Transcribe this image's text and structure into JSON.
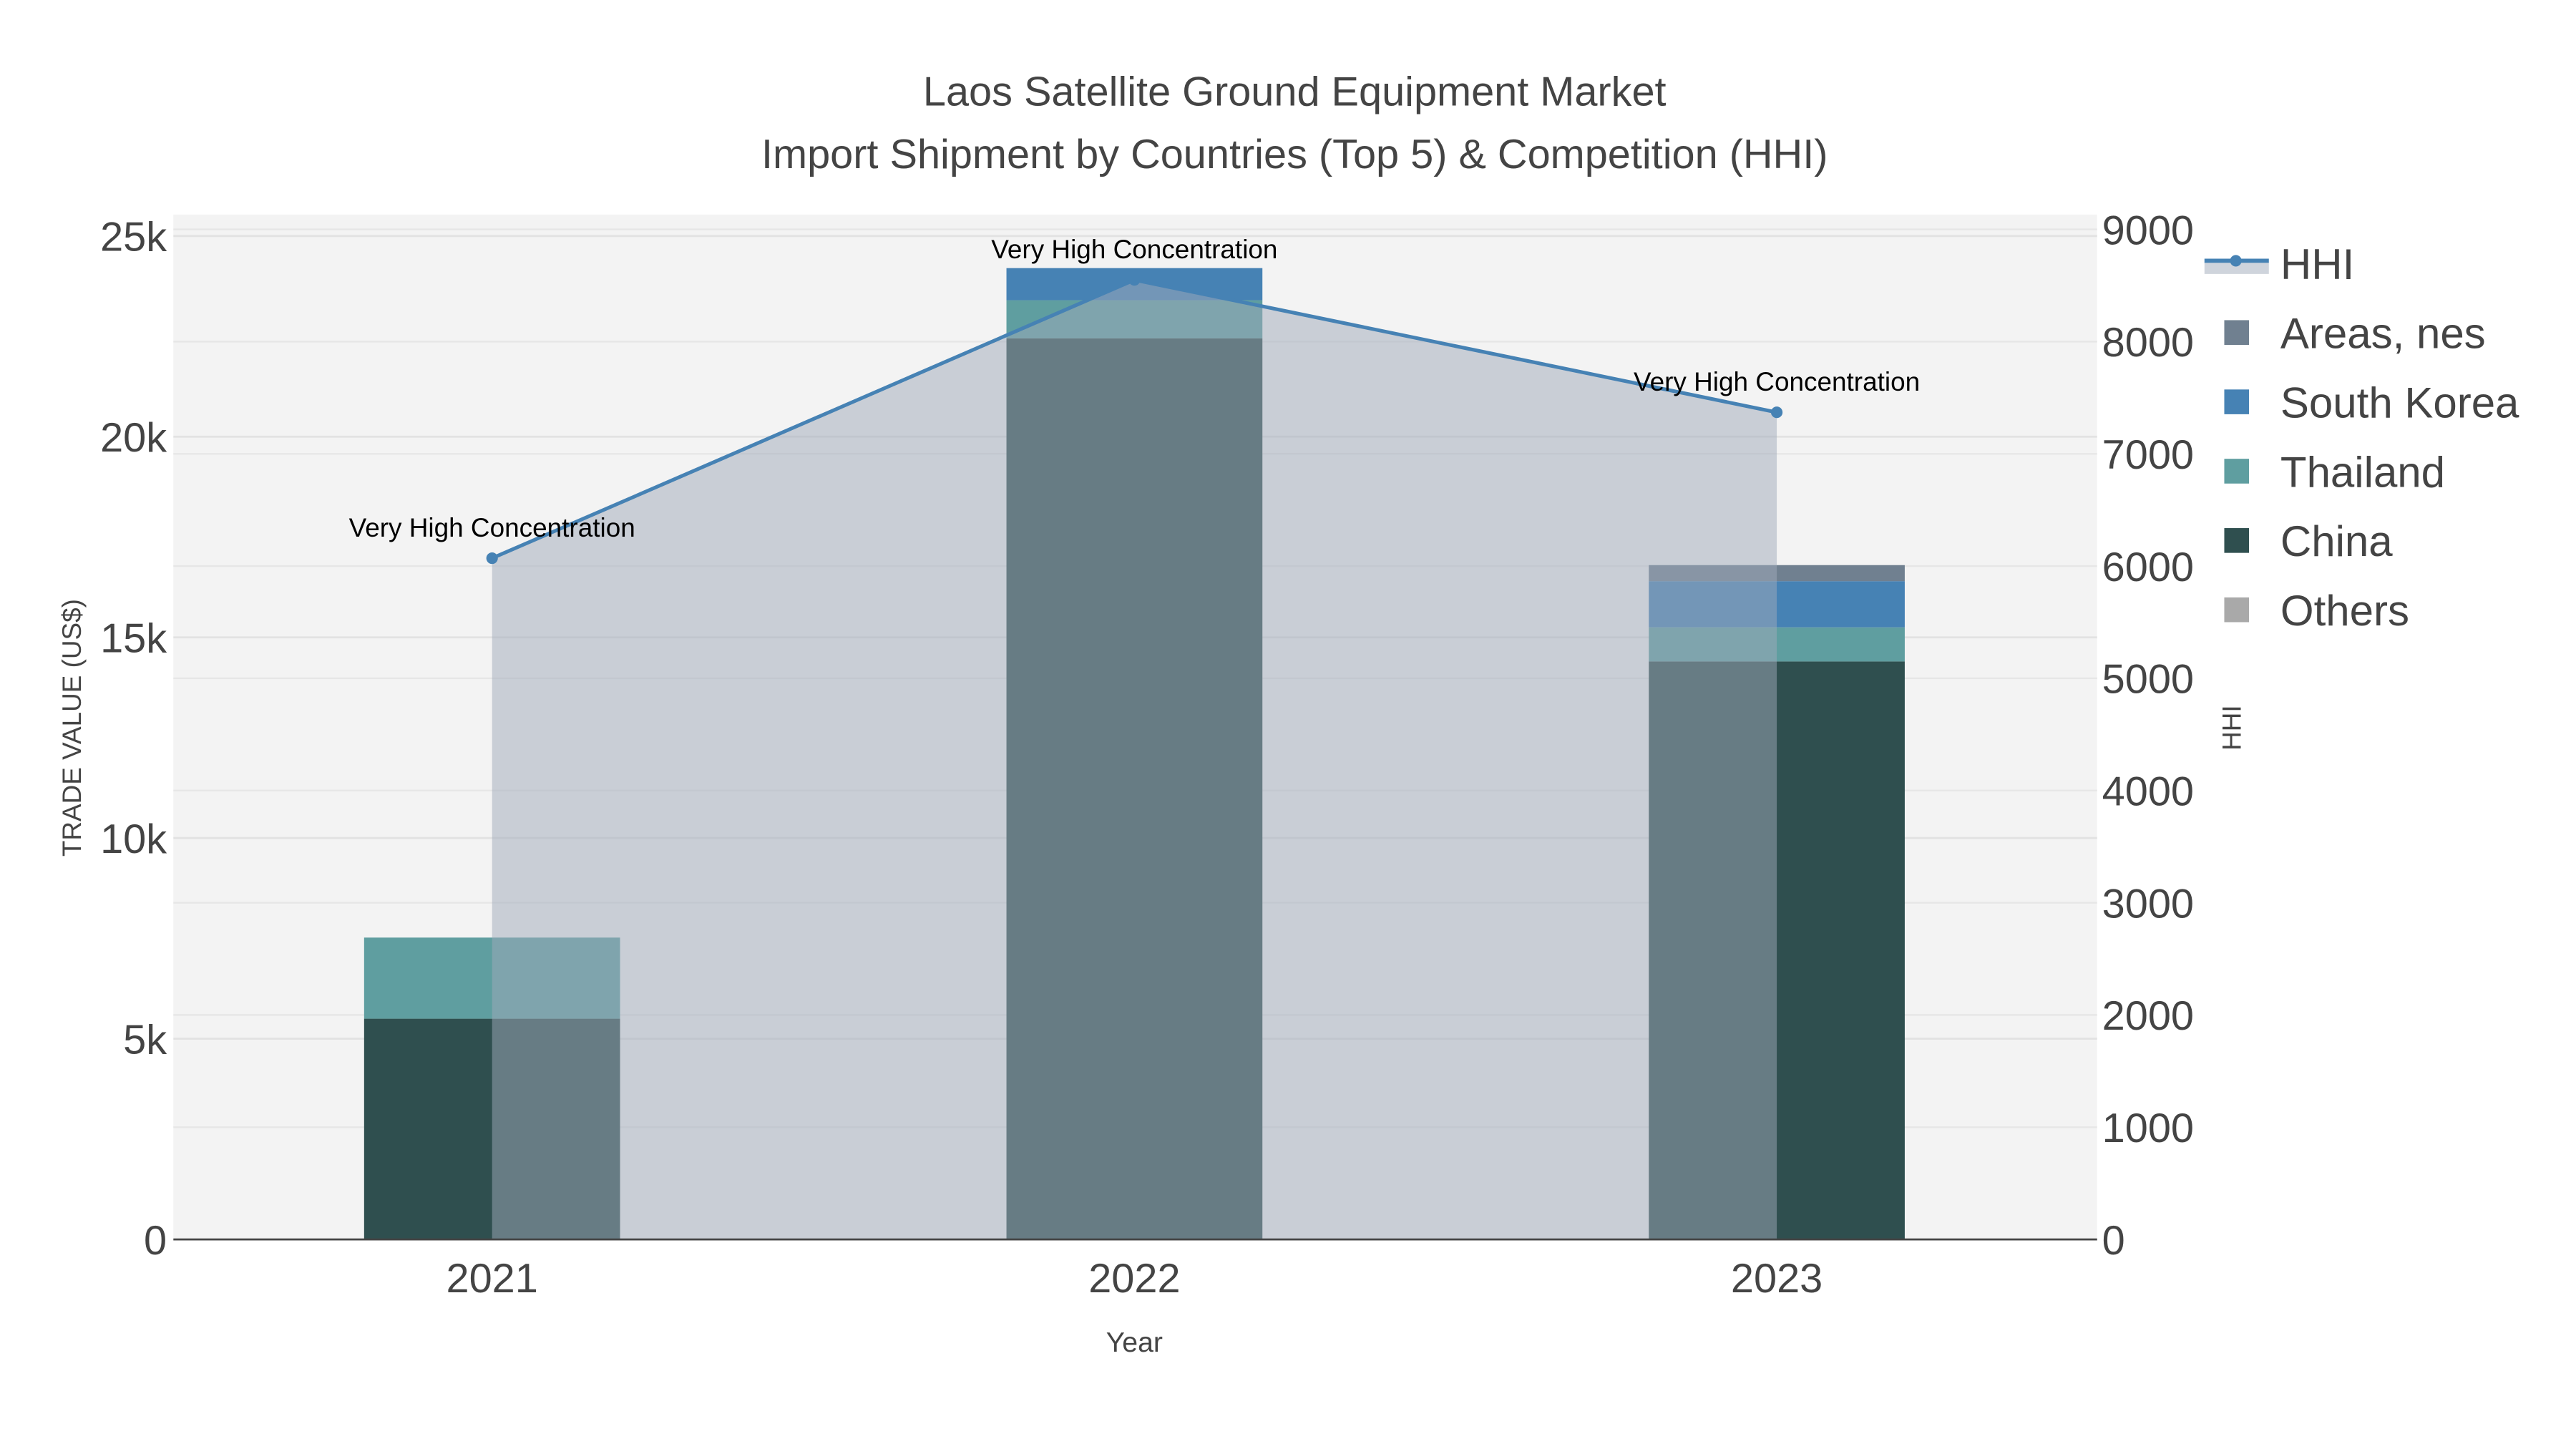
{
  "chart_data": {
    "type": "bar",
    "title": "Laos Satellite Ground Equipment Market",
    "subtitle": "Import Shipment by Countries (Top 5) & Competition (HHI)",
    "xlabel": "Year",
    "ylabel": "TRADE VALUE (US$)",
    "y2label": "HHI",
    "categories": [
      "2021",
      "2022",
      "2023"
    ],
    "ylim": [
      0,
      25000
    ],
    "y2lim": [
      0,
      9000
    ],
    "yticks": [
      0,
      5000,
      10000,
      15000,
      20000,
      25000
    ],
    "ytick_labels": [
      "0",
      "5k",
      "10k",
      "15k",
      "20k",
      "25k"
    ],
    "y2ticks": [
      0,
      1000,
      2000,
      3000,
      4000,
      5000,
      6000,
      7000,
      8000,
      9000
    ],
    "y2tick_labels": [
      "0",
      "1000",
      "2000",
      "3000",
      "4000",
      "5000",
      "6000",
      "7000",
      "8000",
      "9000"
    ],
    "stacked": true,
    "series": [
      {
        "name": "China",
        "color": "#2F4F4F",
        "values": [
          5500,
          22450,
          14400
        ]
      },
      {
        "name": "Thailand",
        "color": "#5F9EA0",
        "values": [
          2020,
          950,
          850
        ]
      },
      {
        "name": "South Korea",
        "color": "#4682B4",
        "values": [
          0,
          800,
          1150
        ]
      },
      {
        "name": "Areas, nes",
        "color": "#708090",
        "values": [
          0,
          0,
          400
        ]
      },
      {
        "name": "Others",
        "color": "#A9A9A9",
        "values": [
          0,
          0,
          0
        ]
      }
    ],
    "hhi": {
      "name": "HHI",
      "color": "#4682B4",
      "fill": "rgba(160,170,185,0.5)",
      "values": [
        6070,
        8550,
        7370
      ],
      "annotations": [
        "Very High Concentration",
        "Very High Concentration",
        "Very High Concentration"
      ]
    },
    "legend": {
      "placement": "right",
      "order": [
        "HHI",
        "Areas, nes",
        "South Korea",
        "Thailand",
        "China",
        "Others"
      ]
    },
    "grid": true
  }
}
